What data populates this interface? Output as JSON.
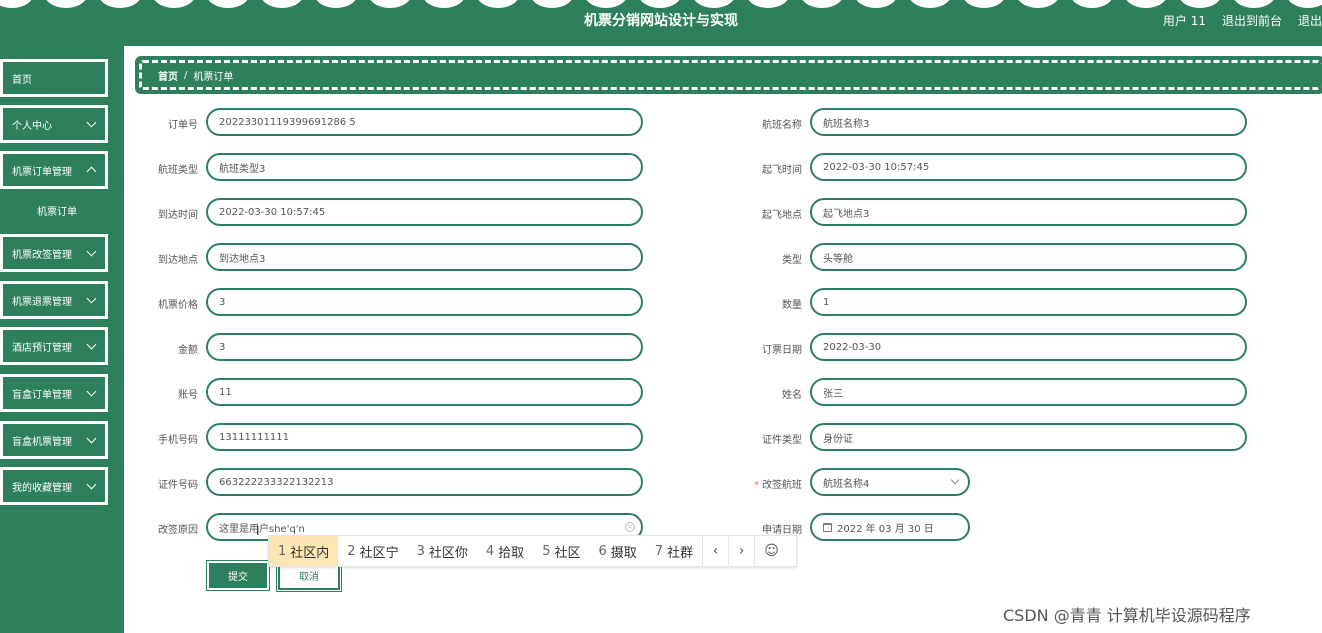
{
  "header": {
    "title": "机票分销网站设计与实现",
    "user": "用户 11",
    "to_front": "退出到前台",
    "logout": "退出"
  },
  "sidebar": {
    "items": [
      {
        "label": "首页"
      },
      {
        "label": "个人中心"
      },
      {
        "label": "机票订单管理"
      },
      {
        "label": "机票订单"
      },
      {
        "label": "机票改签管理"
      },
      {
        "label": "机票退票管理"
      },
      {
        "label": "酒店预订管理"
      },
      {
        "label": "盲盒订单管理"
      },
      {
        "label": "盲盒机票管理"
      },
      {
        "label": "我的收藏管理"
      }
    ]
  },
  "breadcrumb": {
    "home": "首页",
    "separator": "/",
    "current": "机票订单"
  },
  "form": {
    "order_no": {
      "label": "订单号",
      "value": "20223301119399691286 5"
    },
    "flight_name": {
      "label": "航班名称",
      "value": "航班名称3"
    },
    "flight_type": {
      "label": "航班类型",
      "value": "航班类型3"
    },
    "depart_time": {
      "label": "起飞时间",
      "value": "2022-03-30 10:57:45"
    },
    "arrive_time": {
      "label": "到达时间",
      "value": "2022-03-30 10:57:45"
    },
    "depart_place": {
      "label": "起飞地点",
      "value": "起飞地点3"
    },
    "arrive_place": {
      "label": "到达地点",
      "value": "到达地点3"
    },
    "type": {
      "label": "类型",
      "value": "头等舱"
    },
    "price": {
      "label": "机票价格",
      "value": "3"
    },
    "quantity": {
      "label": "数量",
      "value": "1"
    },
    "amount": {
      "label": "金额",
      "value": "3"
    },
    "order_date": {
      "label": "订票日期",
      "value": "2022-03-30"
    },
    "account": {
      "label": "账号",
      "value": "11"
    },
    "name": {
      "label": "姓名",
      "value": "张三"
    },
    "phone": {
      "label": "手机号码",
      "value": "13111111111"
    },
    "id_type": {
      "label": "证件类型",
      "value": "身份证"
    },
    "id_no": {
      "label": "证件号码",
      "value": "663222233322132213"
    },
    "change_flight": {
      "label": "改签航班",
      "required": "*",
      "value": "航班名称4"
    },
    "change_reason": {
      "label": "改签原因",
      "value": "这里是用户she'q'n"
    },
    "apply_date": {
      "label": "申请日期",
      "value": "2022 年 03 月 30 日"
    }
  },
  "ime": {
    "candidates": [
      {
        "num": "1",
        "text": "社区内"
      },
      {
        "num": "2",
        "text": "社区宁"
      },
      {
        "num": "3",
        "text": "社区你"
      },
      {
        "num": "4",
        "text": "拾取"
      },
      {
        "num": "5",
        "text": "社区"
      },
      {
        "num": "6",
        "text": "摄取"
      },
      {
        "num": "7",
        "text": "社群"
      }
    ],
    "prev": "‹",
    "next": "›",
    "emoji": "☺"
  },
  "buttons": {
    "submit": "提交",
    "cancel": "取消"
  },
  "watermark": "CSDN @青青  计算机毕设源码程序"
}
